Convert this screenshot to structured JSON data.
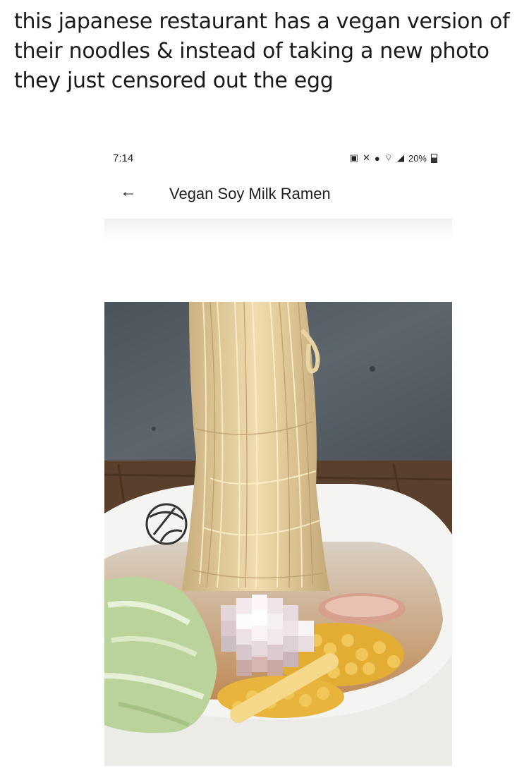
{
  "post": {
    "caption": "this japanese restaurant has a vegan version of their noodles & instead of taking a new photo they just censored out the egg"
  },
  "status_bar": {
    "time": "7:14",
    "battery": "20%"
  },
  "app": {
    "back_icon": "arrow-left-icon",
    "title": "Vegan Soy Milk Ramen"
  },
  "photo": {
    "subject": "ramen bowl with noodles lifted, corn, cabbage, and a pixelated egg",
    "colors": {
      "wall": "#525a62",
      "table": "#5a3f2c",
      "bowl": "#f4f4f2",
      "noodle": "#e6cf9c",
      "corn": "#e3ad34",
      "cabbage": "#b9d39b",
      "mosaic": "#f0e6ea"
    }
  }
}
